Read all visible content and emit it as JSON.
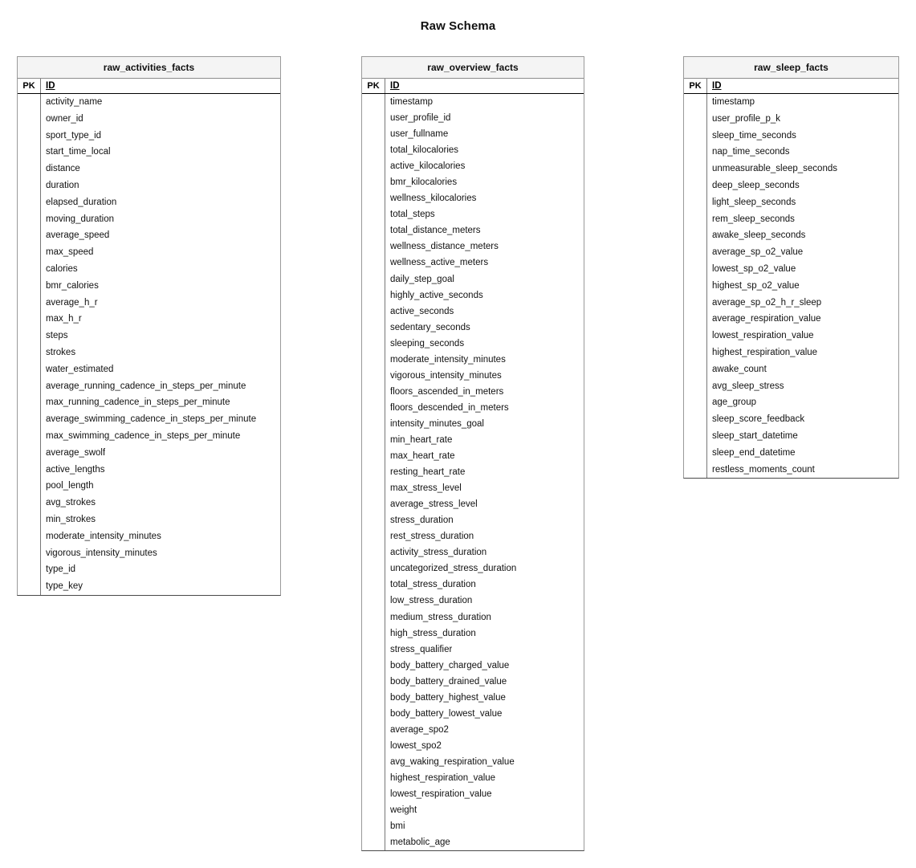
{
  "title": "Raw Schema",
  "column_headers": {
    "pk": "PK",
    "id": "ID"
  },
  "entities": [
    {
      "name": "raw_activities_facts",
      "fields": [
        "activity_name",
        "owner_id",
        "sport_type_id",
        "start_time_local",
        "distance",
        "duration",
        "elapsed_duration",
        "moving_duration",
        "average_speed",
        "max_speed",
        "calories",
        "bmr_calories",
        "average_h_r",
        "max_h_r",
        "steps",
        "strokes",
        "water_estimated",
        "average_running_cadence_in_steps_per_minute",
        "max_running_cadence_in_steps_per_minute",
        "average_swimming_cadence_in_steps_per_minute",
        "max_swimming_cadence_in_steps_per_minute",
        "average_swolf",
        "active_lengths",
        "pool_length",
        "avg_strokes",
        "min_strokes",
        "moderate_intensity_minutes",
        "vigorous_intensity_minutes",
        "type_id",
        "type_key"
      ]
    },
    {
      "name": "raw_overview_facts",
      "fields": [
        "timestamp",
        "user_profile_id",
        "user_fullname",
        "total_kilocalories",
        "active_kilocalories",
        "bmr_kilocalories",
        "wellness_kilocalories",
        "total_steps",
        "total_distance_meters",
        "wellness_distance_meters",
        "wellness_active_meters",
        "daily_step_goal",
        "highly_active_seconds",
        "active_seconds",
        "sedentary_seconds",
        "sleeping_seconds",
        "moderate_intensity_minutes",
        "vigorous_intensity_minutes",
        "floors_ascended_in_meters",
        "floors_descended_in_meters",
        "intensity_minutes_goal",
        "min_heart_rate",
        "max_heart_rate",
        "resting_heart_rate",
        "max_stress_level",
        "average_stress_level",
        "stress_duration",
        "rest_stress_duration",
        "activity_stress_duration",
        "uncategorized_stress_duration",
        "total_stress_duration",
        "low_stress_duration",
        "medium_stress_duration",
        "high_stress_duration",
        "stress_qualifier",
        "body_battery_charged_value",
        "body_battery_drained_value",
        "body_battery_highest_value",
        "body_battery_lowest_value",
        "average_spo2",
        "lowest_spo2",
        "avg_waking_respiration_value",
        "highest_respiration_value",
        "lowest_respiration_value",
        "weight",
        "bmi",
        "metabolic_age"
      ]
    },
    {
      "name": "raw_sleep_facts",
      "fields": [
        "timestamp",
        "user_profile_p_k",
        "sleep_time_seconds",
        "nap_time_seconds",
        "unmeasurable_sleep_seconds",
        "deep_sleep_seconds",
        "light_sleep_seconds",
        "rem_sleep_seconds",
        "awake_sleep_seconds",
        "average_sp_o2_value",
        "lowest_sp_o2_value",
        "highest_sp_o2_value",
        "average_sp_o2_h_r_sleep",
        "average_respiration_value",
        "lowest_respiration_value",
        "highest_respiration_value",
        "awake_count",
        "avg_sleep_stress",
        "age_group",
        "sleep_score_feedback",
        "sleep_start_datetime",
        "sleep_end_datetime",
        "restless_moments_count"
      ]
    }
  ],
  "colors": {
    "title_band": "#f4f4f4",
    "border": "#9a9a9a",
    "header_rule": "#000000",
    "text": "#111111",
    "background": "#ffffff"
  }
}
